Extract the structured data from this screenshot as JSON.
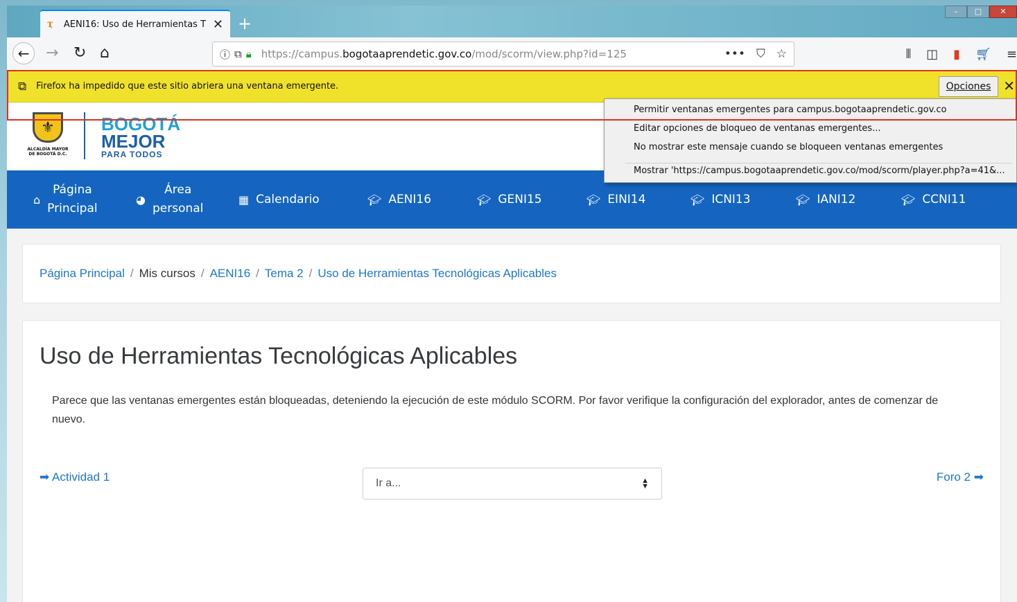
{
  "browser": {
    "tab_title": "AENI16: Uso de Herramientas T",
    "tab_close": "✕",
    "new_tab": "+",
    "url_prefix": "https://campus.",
    "url_domain": "bogotaaprendetic.gov.co",
    "url_path": "/mod/scorm/view.php?id=125"
  },
  "notification": {
    "message": "Firefox ha impedido que este sitio abriera una ventana emergente.",
    "options_label": "Opciones",
    "close_label": "✕"
  },
  "popup_menu": {
    "items": [
      "Permitir ventanas emergentes para campus.bogotaaprendetic.gov.co",
      "Editar opciones de bloqueo de ventanas emergentes...",
      "No mostrar este mensaje cuando se bloqueen ventanas emergentes",
      "Mostrar 'https://campus.bogotaaprendetic.gov.co/mod/scorm/player.php?a=41&..."
    ]
  },
  "header": {
    "crest_text": "ALCALDÍA MAYOR DE BOGOTÁ D.C.",
    "brand_top": "BOGOTÁ",
    "brand_main": "MEJOR",
    "brand_sub": "PARA TODOS"
  },
  "nav": {
    "items": [
      {
        "line1": "Página",
        "line2": "Principal"
      },
      {
        "line1": "Área",
        "line2": "personal"
      },
      {
        "label": "Calendario"
      },
      {
        "label": "AENI16"
      },
      {
        "label": "GENI15"
      },
      {
        "label": "EINI14"
      },
      {
        "label": "ICNI13"
      },
      {
        "label": "IANI12"
      },
      {
        "label": "CCNI11"
      }
    ]
  },
  "breadcrumb": {
    "items": [
      "Página Principal",
      "Mis cursos",
      "AENI16",
      "Tema 2",
      "Uso de Herramientas Tecnológicas Aplicables"
    ],
    "separator": "/"
  },
  "main": {
    "title": "Uso de Herramientas Tecnológicas Aplicables",
    "message": "Parece que las ventanas emergentes están bloqueadas, deteniendo la ejecución de este módulo SCORM. Por favor verifique la configuración del explorador, antes de comenzar de nuevo.",
    "prev_link": "➡ Actividad 1",
    "prev_text": "Actividad 1",
    "next_text": "Foro 2",
    "jump_placeholder": "Ir a..."
  },
  "colors": {
    "nav_blue": "#1565c0",
    "notification_yellow": "#f0e22a",
    "link_blue": "#1f77c8",
    "highlight_red": "#e1301d"
  },
  "icons": [
    "back-arrow-icon",
    "forward-arrow-icon",
    "reload-icon",
    "home-icon",
    "info-icon",
    "popup-blocked-icon",
    "lock-icon",
    "more-icon",
    "pocket-icon",
    "bookmark-star-icon",
    "library-icon",
    "sidebar-icon",
    "extension-icon",
    "cart-icon",
    "menu-icon",
    "home-icon",
    "dashboard-icon",
    "calendar-icon",
    "graduation-cap-icon"
  ]
}
